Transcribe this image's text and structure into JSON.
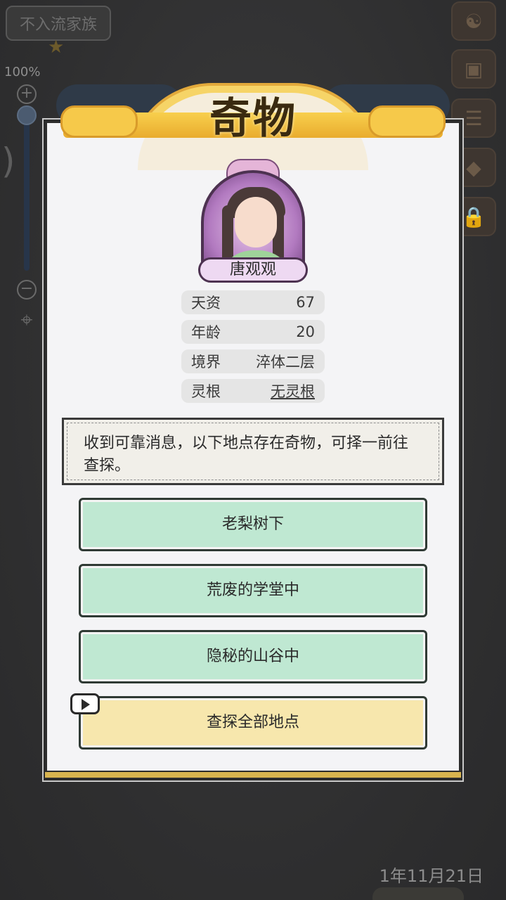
{
  "hud": {
    "clan_name": "不入流家族",
    "zoom_percent": "100%",
    "date": "1年11月21日"
  },
  "dialog": {
    "title": "奇物",
    "character": {
      "name": "唐观观",
      "stats": [
        {
          "label": "天资",
          "value": "67"
        },
        {
          "label": "年龄",
          "value": "20"
        },
        {
          "label": "境界",
          "value": "淬体二层"
        },
        {
          "label": "灵根",
          "value": "无灵根"
        }
      ]
    },
    "message": "收到可靠消息，以下地点存在奇物，可择一前往查探。",
    "options": [
      {
        "label": "老梨树下"
      },
      {
        "label": "荒废的学堂中"
      },
      {
        "label": "隐秘的山谷中"
      }
    ],
    "explore_all": {
      "label": "查探全部地点",
      "icon": "video-ad-icon"
    }
  },
  "colors": {
    "option_bg": "#bfe8d2",
    "explore_all_bg": "#f7e7ad",
    "title_banner": "#f6d467",
    "portrait_bg": "#b27ac0"
  }
}
